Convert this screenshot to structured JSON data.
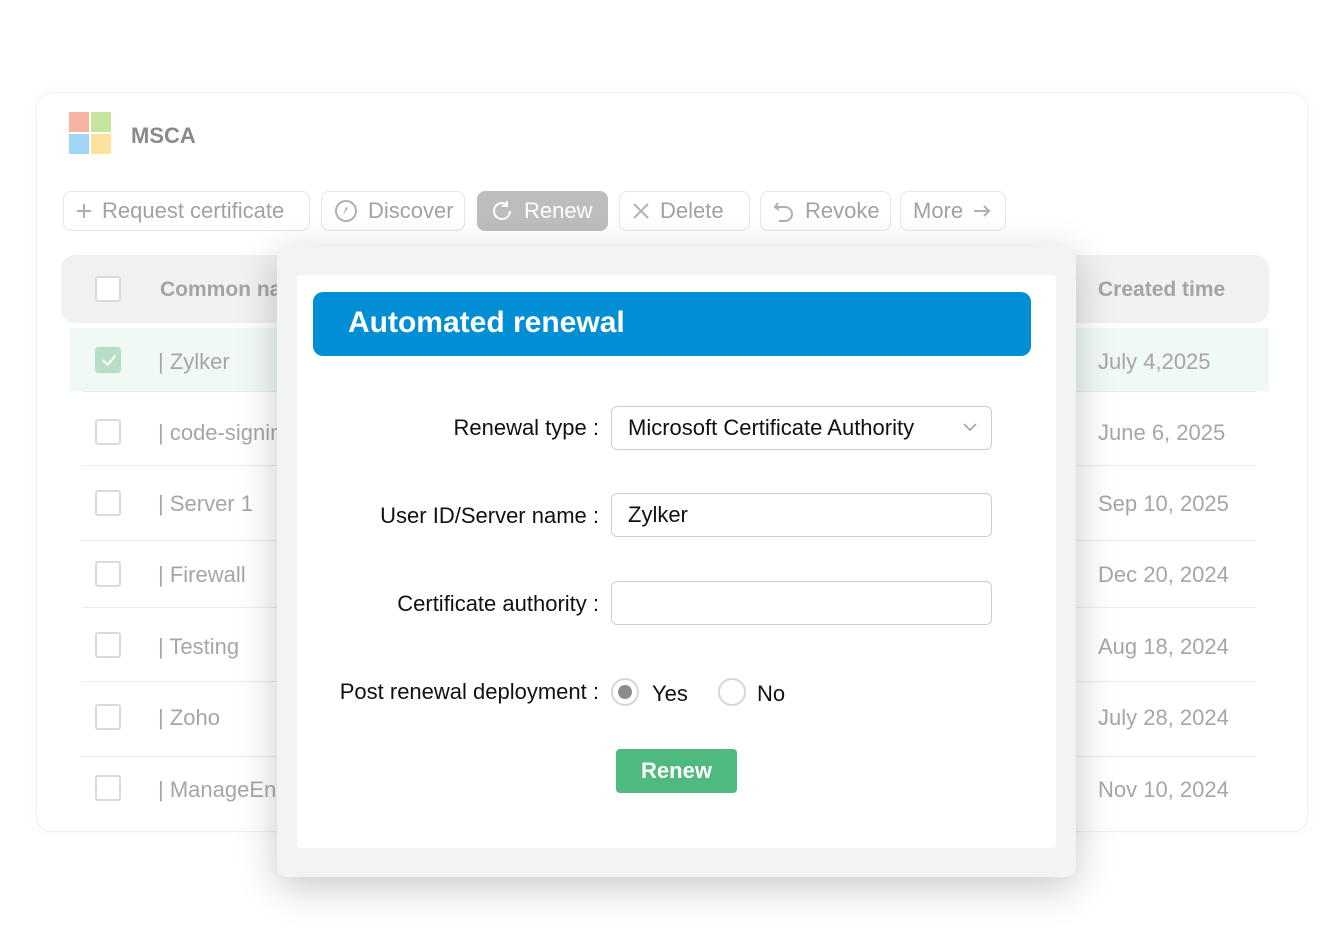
{
  "app": {
    "title": "MSCA"
  },
  "toolbar": {
    "request_label": "Request certificate",
    "discover_label": "Discover",
    "renew_label": "Renew",
    "delete_label": "Delete",
    "revoke_label": "Revoke",
    "more_label": "More"
  },
  "table": {
    "columns": {
      "common_name": "Common nam",
      "created_time": "Created time"
    },
    "rows": [
      {
        "name": "| Zylker",
        "created": "July 4,2025",
        "selected": true
      },
      {
        "name": "| code-signing",
        "created": "June 6, 2025",
        "selected": false
      },
      {
        "name": "| Server 1",
        "created": "Sep 10, 2025",
        "selected": false
      },
      {
        "name": "| Firewall",
        "created": "Dec 20, 2024",
        "selected": false
      },
      {
        "name": "| Testing",
        "created": "Aug 18, 2024",
        "selected": false
      },
      {
        "name": "| Zoho",
        "created": "July 28, 2024",
        "selected": false
      },
      {
        "name": "| ManageEngi",
        "created": "Nov 10, 2024",
        "selected": false
      }
    ]
  },
  "modal": {
    "title": "Automated renewal",
    "renewal_type_label": "Renewal type :",
    "renewal_type_value": "Microsoft Certificate Authority",
    "user_label": "User ID/Server name :",
    "user_value": "Zylker",
    "ca_label": "Certificate authority :",
    "ca_value": "",
    "post_label": "Post renewal deployment :",
    "yes_label": "Yes",
    "no_label": "No",
    "post_selected": "Yes",
    "renew_button": "Renew"
  },
  "colors": {
    "header_blue": "#008fd5",
    "renew_green": "#4fba80",
    "selected_row": "#f1f9f4"
  }
}
